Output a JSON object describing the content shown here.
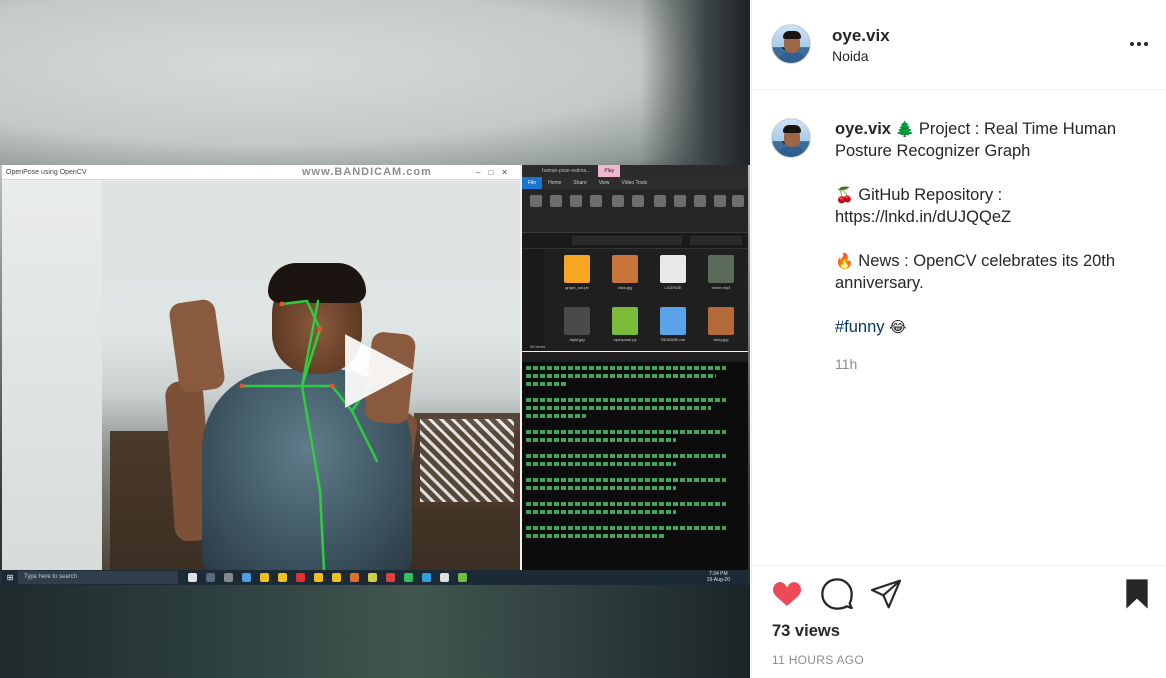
{
  "media": {
    "capture_window_title": "OpenPose using OpenCV",
    "watermark": "www.BANDICAM.com",
    "explorer": {
      "tabs": [
        "human-pose-estima...",
        "Play"
      ],
      "ribbon_tabs": [
        "File",
        "Home",
        "Share",
        "View",
        "Video Tools"
      ],
      "files": [
        {
          "name": "graph_out.pb",
          "color": "#f5a623"
        },
        {
          "name": "vista.jpg",
          "color": "#c8743a"
        },
        {
          "name": "LICENSE",
          "color": "#e8e8e8"
        },
        {
          "name": "move.mp4",
          "color": "#5b6b5a"
        },
        {
          "name": "night.jpg",
          "color": "#4a4a4a"
        },
        {
          "name": "openpose.py",
          "color": "#7cba3a"
        },
        {
          "name": "README.md",
          "color": "#5aa3e8"
        },
        {
          "name": "vicky.jpg",
          "color": "#b56a3a"
        }
      ],
      "item_count": "56 items"
    },
    "taskbar": {
      "search_placeholder": "Type here to search",
      "clock_time": "7:34 PM",
      "clock_date": "19-Aug-20"
    }
  },
  "post": {
    "header": {
      "username": "oye.vix",
      "location": "Noida"
    },
    "caption": {
      "username": "oye.vix",
      "lines": [
        {
          "emoji": "🌲",
          "text": "Project : Real Time Human Posture Recognizer Graph"
        },
        {
          "emoji": "🍒",
          "text": "GitHub Repository :",
          "text2": "https://lnkd.in/dUJQQeZ"
        },
        {
          "emoji": "🔥",
          "text": "News : OpenCV celebrates its 20th anniversary."
        }
      ],
      "hashtag": "#funny",
      "hashtag_emoji": "😂"
    },
    "time_ago": "11h",
    "liked": true,
    "views": "73 views",
    "posted": "11 HOURS AGO",
    "colors": {
      "like_red": "#ed4956",
      "hashtag_blue": "#00376b",
      "secondary_gray": "#8e8e8e"
    }
  }
}
